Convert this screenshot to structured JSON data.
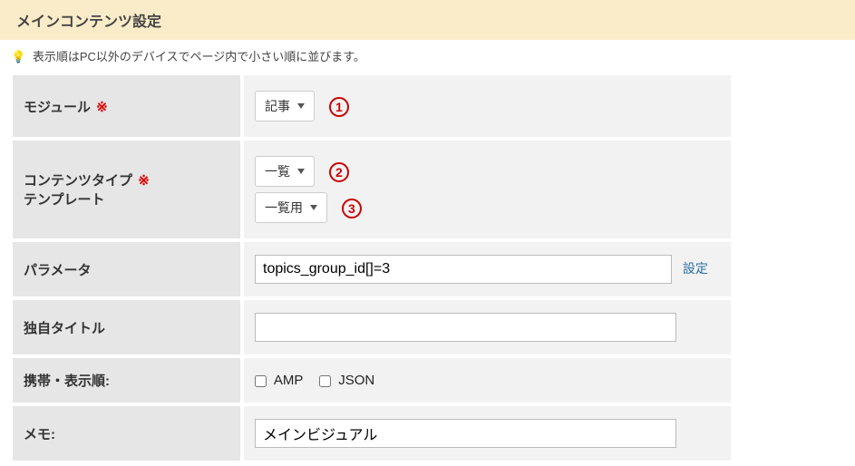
{
  "header": {
    "title": "メインコンテンツ設定"
  },
  "hint": {
    "text": "表示順はPC以外のデバイスでページ内で小さい順に並びます。"
  },
  "rows": {
    "module": {
      "label": "モジュール",
      "required": "※",
      "dropdown": "記事",
      "annotation": "1"
    },
    "content_type": {
      "label": "コンテンツタイプ",
      "required": "※",
      "label2": "テンプレート",
      "dropdown1": "一覧",
      "annotation1": "2",
      "dropdown2": "一覧用",
      "annotation2": "3"
    },
    "parameter": {
      "label": "パラメータ",
      "value": "topics_group_id[]=3",
      "link": "設定"
    },
    "custom_title": {
      "label": "独自タイトル",
      "value": ""
    },
    "mobile_order": {
      "label": "携帯・表示順:",
      "chk1": "AMP",
      "chk2": "JSON"
    },
    "memo": {
      "label": "メモ:",
      "value": "メインビジュアル"
    }
  }
}
